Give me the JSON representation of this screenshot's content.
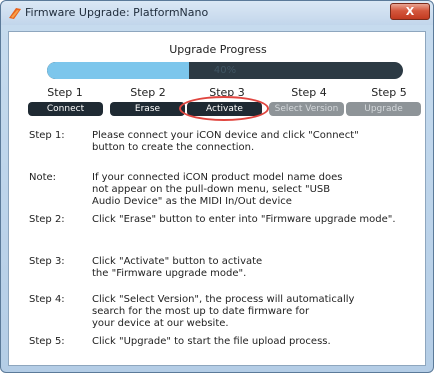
{
  "window": {
    "title": "Firmware Upgrade: PlatformNano",
    "close_label": "X"
  },
  "progress": {
    "title": "Upgrade Progress",
    "percent": 40,
    "text": "40%"
  },
  "steps": [
    {
      "label": "Step 1",
      "button": "Connect",
      "state": "active"
    },
    {
      "label": "Step 2",
      "button": "Erase",
      "state": "active"
    },
    {
      "label": "Step 3",
      "button": "Activate",
      "state": "active",
      "highlighted": true
    },
    {
      "label": "Step 4",
      "button": "Select Version",
      "state": "disabled"
    },
    {
      "label": "Step 5",
      "button": "Upgrade",
      "state": "disabled"
    }
  ],
  "instructions": [
    {
      "label": "Step 1:",
      "lines": [
        "Please connect your iCON device and click \"Connect\"",
        "button to create the connection."
      ]
    },
    {
      "label": "Note:",
      "lines": [
        "If your connected iCON product model name does",
        "not appear on the pull-down menu, select \"USB",
        "Audio Device\" as the MIDI In/Out device"
      ]
    },
    {
      "label": "Step 2:",
      "lines": [
        "Click \"Erase\" button to enter into \"Firmware upgrade mode\"."
      ]
    },
    {
      "label": "Step 3:",
      "lines": [
        "Click \"Activate\" button to activate",
        "the \"Firmware upgrade mode\"."
      ]
    },
    {
      "label": "Step 4:",
      "lines": [
        "Click \"Select Version\", the process will automatically",
        "search for the most up to date firmware for",
        "your device at our website."
      ]
    },
    {
      "label": "Step 5:",
      "lines": [
        "Click \"Upgrade\" to start the file upload process."
      ]
    }
  ],
  "colors": {
    "accent_fill": "#7cc6ec",
    "button_dark": "#1f2a33",
    "button_disabled": "#8e9498",
    "highlight_ring": "#e0453f",
    "close_red": "#c23a20"
  }
}
